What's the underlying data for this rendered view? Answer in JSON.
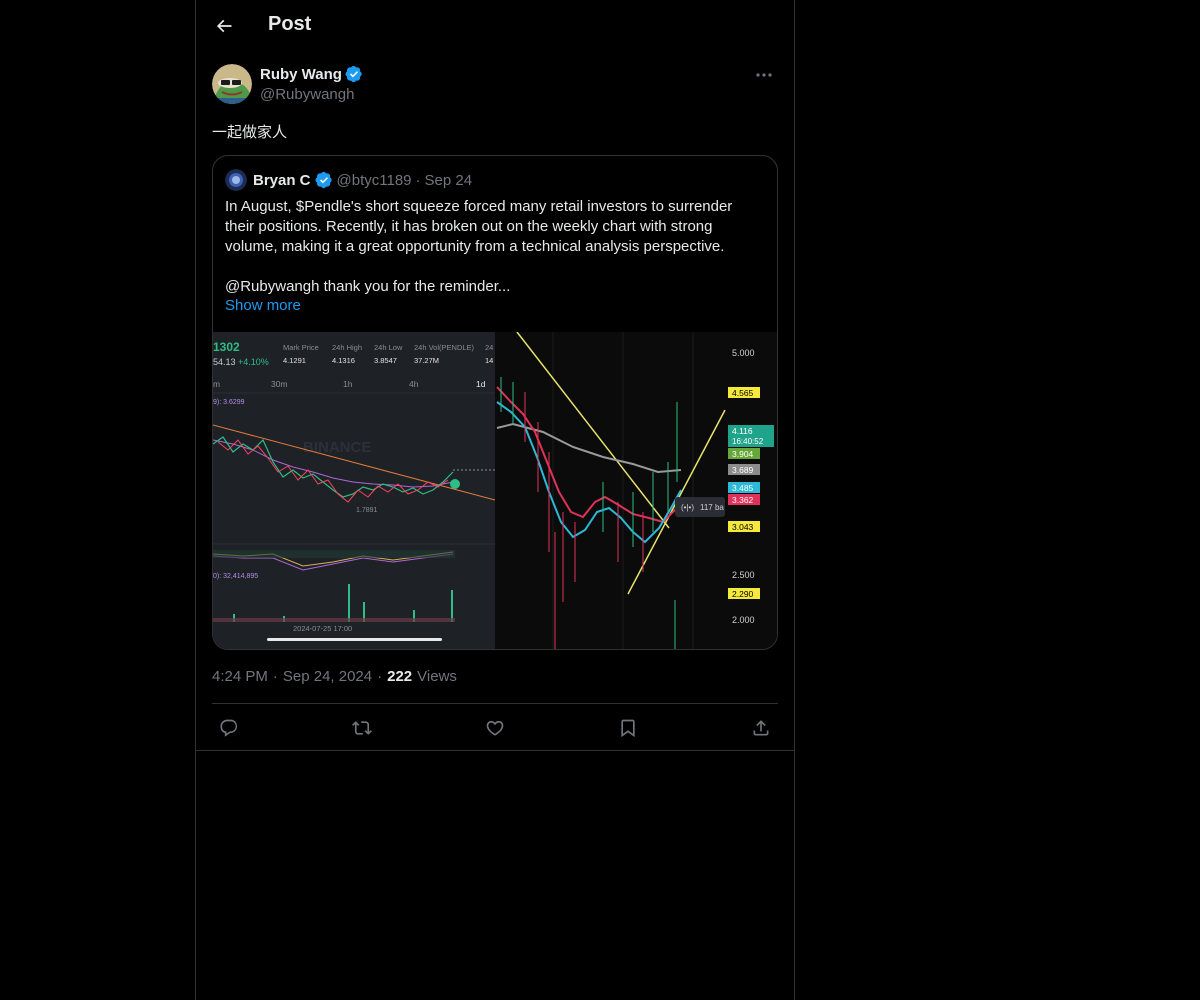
{
  "header": {
    "title": "Post",
    "back_icon": "arrow-left-icon"
  },
  "author": {
    "name": "Ruby Wang",
    "handle": "@Rubywangh",
    "verified": true,
    "badge_color": "#1d9bf0"
  },
  "post": {
    "text": "一起做家人"
  },
  "quote": {
    "name": "Bryan C",
    "handle": "@btyc1189",
    "separator": "·",
    "date": "Sep 24",
    "lines": [
      "In August, $Pendle's short squeeze forced many retail investors to surrender",
      "their positions. Recently, it has broken out on the weekly chart with strong",
      "volume, making it a great opportunity from a technical analysis perspective."
    ],
    "mention_line": "@Rubywangh thank you for the reminder...",
    "show_more": "Show more",
    "media": {
      "left_panel": {
        "price": "1302",
        "change_prefix": "54.13",
        "change": "+4.10%",
        "stats": [
          {
            "label": "Mark Price",
            "value": "4.1291"
          },
          {
            "label": "24h High",
            "value": "4.1316"
          },
          {
            "label": "24h Low",
            "value": "3.8547"
          },
          {
            "label": "24h Vol(PENDLE)",
            "value": "37.27M"
          },
          {
            "label": "24",
            "value": "14"
          }
        ],
        "timeframes": [
          "m",
          "30m",
          "1h",
          "4h",
          "1d"
        ],
        "indicator": "9): 3.6299",
        "watermark": "BINANCE",
        "low_label": "1.7891",
        "volume_label": "0): 32,414,895",
        "date_label": "2024-07-25 17:00"
      },
      "right_panel": {
        "axis_ticks": [
          "5.000",
          "2.500",
          "2.000"
        ],
        "price_tags": [
          {
            "value": "4.565",
            "color": "#f5e93b",
            "text_color": "#000"
          },
          {
            "value": "4.116",
            "sub": "16:40:52",
            "color": "#1fa38a",
            "text_color": "#fff"
          },
          {
            "value": "3.904",
            "color": "#67a639",
            "text_color": "#fff"
          },
          {
            "value": "3.689",
            "color": "#8c8c8c",
            "text_color": "#fff"
          },
          {
            "value": "3.485",
            "color": "#2cb8d6",
            "text_color": "#fff"
          },
          {
            "value": "3.362",
            "color": "#e0315a",
            "text_color": "#fff"
          },
          {
            "value": "3.043",
            "color": "#f5e93b",
            "text_color": "#000"
          },
          {
            "value": "2.290",
            "color": "#f5e93b",
            "text_color": "#000"
          }
        ],
        "bars_label": "117 ba"
      }
    }
  },
  "meta": {
    "time": "4:24 PM",
    "dot": "·",
    "date": "Sep 24, 2024",
    "views_count": "222",
    "views_label": "Views"
  },
  "actions": [
    "reply-icon",
    "repost-icon",
    "like-icon",
    "bookmark-icon",
    "share-icon"
  ]
}
